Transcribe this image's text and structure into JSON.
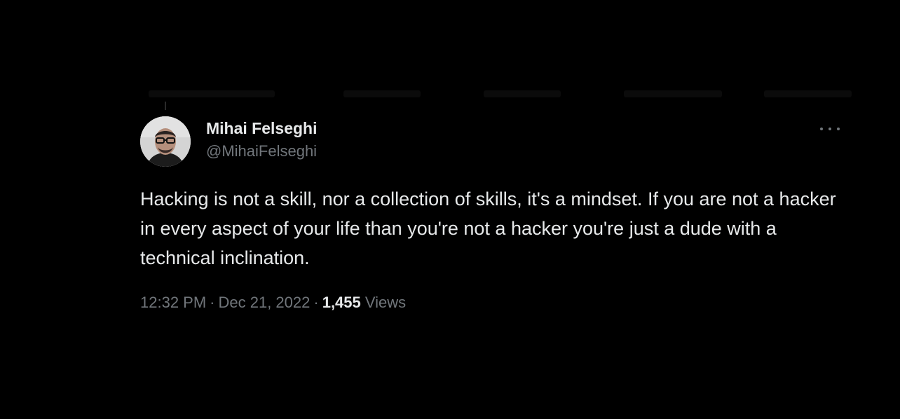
{
  "tweet": {
    "author": {
      "display_name": "Mihai Felseghi",
      "handle": "@MihaiFelseghi",
      "avatar_icon": "profile-photo"
    },
    "more_icon": "more-options-icon",
    "text": "Hacking is not a skill, nor a collection of skills, it's a mindset. If you are not a hacker in every aspect of your life than you're not a hacker you're just a dude with a technical inclination.",
    "time": "12:32 PM",
    "separator": "·",
    "date": "Dec 21, 2022",
    "views_count": "1,455",
    "views_label": "Views"
  },
  "colors": {
    "background": "#000000",
    "primary_text": "#e7e9ea",
    "secondary_text": "#71767b"
  }
}
